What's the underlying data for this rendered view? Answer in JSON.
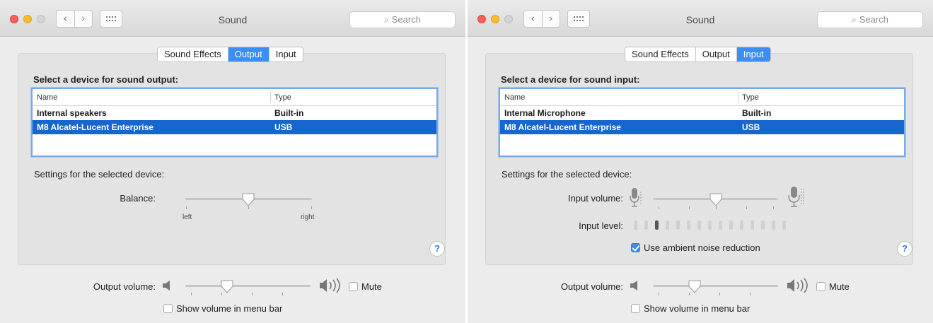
{
  "left": {
    "window_title": "Sound",
    "search_placeholder": "Search",
    "tabs": [
      {
        "label": "Sound Effects",
        "active": false
      },
      {
        "label": "Output",
        "active": true
      },
      {
        "label": "Input",
        "active": false
      }
    ],
    "heading": "Select a device for sound output:",
    "table": {
      "columns": [
        "Name",
        "Type"
      ],
      "rows": [
        {
          "name": "Internal speakers",
          "type": "Built-in",
          "selected": false
        },
        {
          "name": "M8 Alcatel-Lucent Enterprise",
          "type": "USB",
          "selected": true
        }
      ]
    },
    "settings_label": "Settings for the selected device:",
    "balance": {
      "label": "Balance:",
      "left_label": "left",
      "right_label": "right",
      "value": 0.5
    },
    "output_volume": {
      "label": "Output volume:",
      "value": 0.33
    },
    "mute_label": "Mute",
    "mute_checked": false,
    "show_volume_label": "Show volume in menu bar",
    "show_volume_checked": false,
    "help_symbol": "?"
  },
  "right": {
    "window_title": "Sound",
    "search_placeholder": "Search",
    "tabs": [
      {
        "label": "Sound Effects",
        "active": false
      },
      {
        "label": "Output",
        "active": false
      },
      {
        "label": "Input",
        "active": true
      }
    ],
    "heading": "Select a device for sound input:",
    "table": {
      "columns": [
        "Name",
        "Type"
      ],
      "rows": [
        {
          "name": "Internal Microphone",
          "type": "Built-in",
          "selected": false
        },
        {
          "name": "M8 Alcatel-Lucent Enterprise",
          "type": "USB",
          "selected": true
        }
      ]
    },
    "settings_label": "Settings for the selected device:",
    "input_volume": {
      "label": "Input volume:",
      "value": 0.5
    },
    "input_level": {
      "label": "Input level:",
      "segments": 15,
      "active_index": 2
    },
    "ambient_noise_label": "Use ambient noise reduction",
    "ambient_noise_checked": true,
    "output_volume": {
      "label": "Output volume:",
      "value": 0.33
    },
    "mute_label": "Mute",
    "mute_checked": false,
    "show_volume_label": "Show volume in menu bar",
    "show_volume_checked": false,
    "help_symbol": "?"
  },
  "colors": {
    "accent": "#3b8ef5",
    "selection": "#1765cf",
    "close": "#fc5f57",
    "minimize": "#fdbc2e"
  },
  "icons": [
    "close-light-icon",
    "minimize-light-icon",
    "zoom-light-icon",
    "back-arrow-icon",
    "forward-arrow-icon",
    "grid-icon",
    "search-icon",
    "speaker-low-icon",
    "speaker-high-icon",
    "microphone-low-icon",
    "microphone-high-icon",
    "help-icon",
    "checkmark-icon"
  ]
}
